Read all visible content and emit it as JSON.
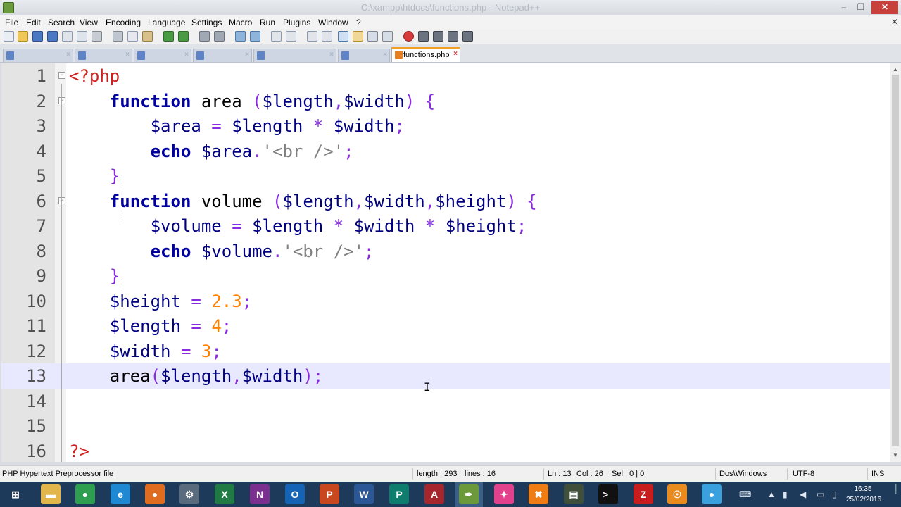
{
  "window": {
    "title": "C:\\xampp\\htdocs\\functions.php - Notepad++",
    "min_glyph": "–",
    "max_glyph": "❐",
    "close_glyph": "✕",
    "mdi_close_glyph": "✕"
  },
  "menu": [
    "File",
    "Edit",
    "Search",
    "View",
    "Encoding",
    "Language",
    "Settings",
    "Macro",
    "Run",
    "Plugins",
    "Window",
    "?"
  ],
  "tabs": {
    "active_label": "functions.php",
    "close_glyph": "×"
  },
  "editor": {
    "line_numbers": [
      "1",
      "2",
      "3",
      "4",
      "5",
      "6",
      "7",
      "8",
      "9",
      "10",
      "11",
      "12",
      "13",
      "14",
      "15",
      "16"
    ],
    "fold_glyph": "−",
    "lines": [
      [
        [
          "php",
          "<?php"
        ]
      ],
      [
        [
          "sp",
          "    "
        ],
        [
          "kw",
          "function"
        ],
        [
          "fn",
          " area "
        ],
        [
          "op",
          "("
        ],
        [
          "var",
          "$length"
        ],
        [
          "op",
          ","
        ],
        [
          "var",
          "$width"
        ],
        [
          "op",
          ") {"
        ]
      ],
      [
        [
          "sp",
          "        "
        ],
        [
          "var",
          "$area"
        ],
        [
          "op",
          " = "
        ],
        [
          "var",
          "$length"
        ],
        [
          "op",
          " * "
        ],
        [
          "var",
          "$width"
        ],
        [
          "op",
          ";"
        ]
      ],
      [
        [
          "sp",
          "        "
        ],
        [
          "kw",
          "echo"
        ],
        [
          "fn",
          " "
        ],
        [
          "var",
          "$area"
        ],
        [
          "op",
          "."
        ],
        [
          "str",
          "'<br />'"
        ],
        [
          "op",
          ";"
        ]
      ],
      [
        [
          "sp",
          "    "
        ],
        [
          "op",
          "}"
        ]
      ],
      [
        [
          "sp",
          "    "
        ],
        [
          "kw",
          "function"
        ],
        [
          "fn",
          " volume "
        ],
        [
          "op",
          "("
        ],
        [
          "var",
          "$length"
        ],
        [
          "op",
          ","
        ],
        [
          "var",
          "$width"
        ],
        [
          "op",
          ","
        ],
        [
          "var",
          "$height"
        ],
        [
          "op",
          ") {"
        ]
      ],
      [
        [
          "sp",
          "        "
        ],
        [
          "var",
          "$volume"
        ],
        [
          "op",
          " = "
        ],
        [
          "var",
          "$length"
        ],
        [
          "op",
          " * "
        ],
        [
          "var",
          "$width"
        ],
        [
          "op",
          " * "
        ],
        [
          "var",
          "$height"
        ],
        [
          "op",
          ";"
        ]
      ],
      [
        [
          "sp",
          "        "
        ],
        [
          "kw",
          "echo"
        ],
        [
          "fn",
          " "
        ],
        [
          "var",
          "$volume"
        ],
        [
          "op",
          "."
        ],
        [
          "str",
          "'<br />'"
        ],
        [
          "op",
          ";"
        ]
      ],
      [
        [
          "sp",
          "    "
        ],
        [
          "op",
          "}"
        ]
      ],
      [
        [
          "sp",
          "    "
        ],
        [
          "var",
          "$height"
        ],
        [
          "op",
          " = "
        ],
        [
          "num",
          "2.3"
        ],
        [
          "op",
          ";"
        ]
      ],
      [
        [
          "sp",
          "    "
        ],
        [
          "var",
          "$length"
        ],
        [
          "op",
          " = "
        ],
        [
          "num",
          "4"
        ],
        [
          "op",
          ";"
        ]
      ],
      [
        [
          "sp",
          "    "
        ],
        [
          "var",
          "$width"
        ],
        [
          "op",
          " = "
        ],
        [
          "num",
          "3"
        ],
        [
          "op",
          ";"
        ]
      ],
      [
        [
          "sp",
          "    "
        ],
        [
          "fn",
          "area"
        ],
        [
          "op",
          "("
        ],
        [
          "var",
          "$length"
        ],
        [
          "op",
          ","
        ],
        [
          "var",
          "$width"
        ],
        [
          "op",
          ");"
        ]
      ],
      [],
      [],
      [
        [
          "php",
          "?>"
        ]
      ]
    ],
    "current_line": 13
  },
  "status": {
    "file_type": "PHP Hypertext Preprocessor file",
    "length": "length : 293",
    "lines": "lines : 16",
    "ln": "Ln : 13",
    "col": "Col : 26",
    "sel": "Sel : 0 | 0",
    "eol": "Dos\\Windows",
    "encoding": "UTF-8",
    "mode": "INS"
  },
  "taskbar": {
    "apps": [
      {
        "name": "windows-start",
        "glyph": "⊞",
        "color": "#1d3a5a"
      },
      {
        "name": "file-explorer",
        "glyph": "▬",
        "color": "#e2b64a"
      },
      {
        "name": "chrome",
        "glyph": "●",
        "color": "#2e9e4f"
      },
      {
        "name": "internet-explorer",
        "glyph": "e",
        "color": "#1e88d3"
      },
      {
        "name": "firefox",
        "glyph": "●",
        "color": "#e06c1f"
      },
      {
        "name": "settings-gear",
        "glyph": "⚙",
        "color": "#5a6b7d"
      },
      {
        "name": "excel",
        "glyph": "X",
        "color": "#1f7a43"
      },
      {
        "name": "onenote",
        "glyph": "N",
        "color": "#7b2f8f"
      },
      {
        "name": "outlook",
        "glyph": "O",
        "color": "#1563b4"
      },
      {
        "name": "powerpoint",
        "glyph": "P",
        "color": "#c9471f"
      },
      {
        "name": "word",
        "glyph": "W",
        "color": "#2b5797"
      },
      {
        "name": "publisher",
        "glyph": "P",
        "color": "#0f7d6e"
      },
      {
        "name": "access",
        "glyph": "A",
        "color": "#a6262d"
      },
      {
        "name": "notepad-plus-plus",
        "glyph": "✒",
        "color": "#6c9a3a"
      },
      {
        "name": "xampp",
        "glyph": "✦",
        "color": "#e2418c"
      },
      {
        "name": "xampp-control",
        "glyph": "✖",
        "color": "#ef7d14"
      },
      {
        "name": "terminal-app",
        "glyph": "▤",
        "color": "#3f4f3a"
      },
      {
        "name": "command-prompt",
        "glyph": ">_",
        "color": "#111111"
      },
      {
        "name": "filezilla",
        "glyph": "Z",
        "color": "#c81d1d"
      },
      {
        "name": "orange-app",
        "glyph": "☉",
        "color": "#e98b1d"
      },
      {
        "name": "web-browser",
        "glyph": "●",
        "color": "#3aa0de"
      }
    ],
    "clock_time": "16:35",
    "clock_date": "25/02/2016"
  }
}
